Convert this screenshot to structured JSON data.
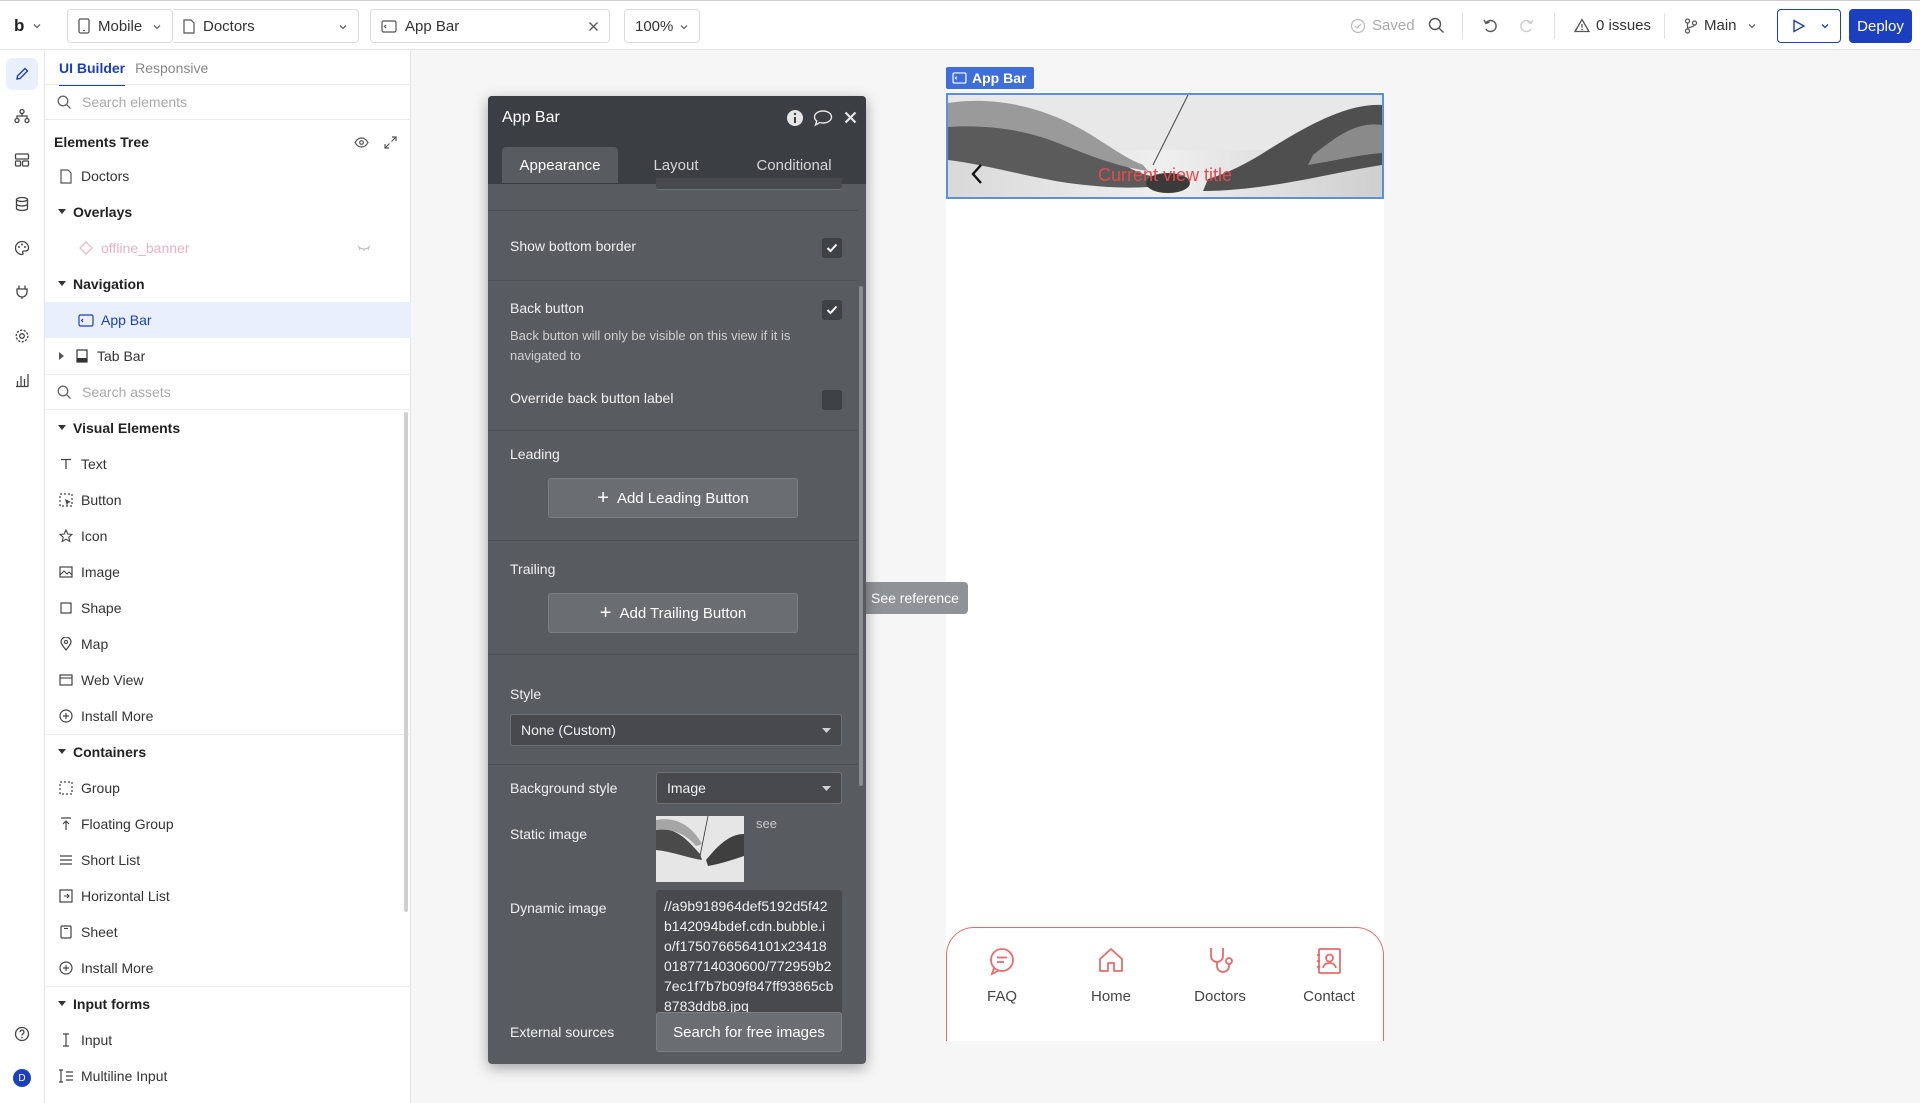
{
  "topbar": {
    "logo": "b",
    "device": "Mobile",
    "page": "Doctors",
    "element": "App Bar",
    "zoom": "100%",
    "saved": "Saved",
    "issues": "0 issues",
    "branch": "Main",
    "deploy": "Deploy"
  },
  "leftpanel": {
    "tabs": [
      "UI Builder",
      "Responsive"
    ],
    "search_elements_placeholder": "Search elements",
    "tree_title": "Elements Tree",
    "tree": {
      "root": "Doctors",
      "overlays": "Overlays",
      "offline_banner": "offline_banner",
      "navigation": "Navigation",
      "app_bar": "App Bar",
      "tab_bar": "Tab Bar"
    },
    "search_assets_placeholder": "Search assets",
    "visual_elements": {
      "title": "Visual Elements",
      "items": [
        "Text",
        "Button",
        "Icon",
        "Image",
        "Shape",
        "Map",
        "Web View",
        "Install More"
      ]
    },
    "containers": {
      "title": "Containers",
      "items": [
        "Group",
        "Floating Group",
        "Short List",
        "Horizontal List",
        "Sheet",
        "Install More"
      ]
    },
    "input_forms": {
      "title": "Input forms",
      "items": [
        "Input",
        "Multiline Input"
      ]
    }
  },
  "editor": {
    "title": "App Bar",
    "tabs": [
      "Appearance",
      "Layout",
      "Conditional"
    ],
    "show_bottom_border": "Show bottom border",
    "back_button": "Back button",
    "back_button_note": "Back button will only be visible on this view if it is navigated to",
    "override_back_label": "Override back button label",
    "leading": "Leading",
    "add_leading": "Add Leading Button",
    "trailing": "Trailing",
    "add_trailing": "Add Trailing Button",
    "style_label": "Style",
    "style_value": "None (Custom)",
    "bg_style_label": "Background style",
    "bg_style_value": "Image",
    "static_image_label": "Static image",
    "see": "see",
    "dynamic_image_label": "Dynamic image",
    "dynamic_image_value": "//a9b918964def5192d5f42b142094bdef.cdn.bubble.io/f1750766564101x234180187714030600/772959b27ec1f7b7b09f847ff93865cb8783ddb8.jpg",
    "external_sources_label": "External sources",
    "search_free_images": "Search for free images",
    "show_bottom_border_checked": true,
    "back_button_checked": true,
    "override_back_checked": false
  },
  "see_reference": "See reference",
  "phone": {
    "appbar_tag": "App Bar",
    "title": "Current view title",
    "tabs": [
      {
        "label": "FAQ",
        "icon": "chat-bubble-icon"
      },
      {
        "label": "Home",
        "icon": "home-icon"
      },
      {
        "label": "Doctors",
        "icon": "stethoscope-icon"
      },
      {
        "label": "Contact",
        "icon": "contact-card-icon"
      }
    ]
  },
  "colors": {
    "accent": "#1b3fbf",
    "canvas_highlight": "#5b8fe0",
    "tabbar_border": "#e96b6b",
    "title_red": "#e34b4b",
    "editor_bg": "#585b60"
  }
}
